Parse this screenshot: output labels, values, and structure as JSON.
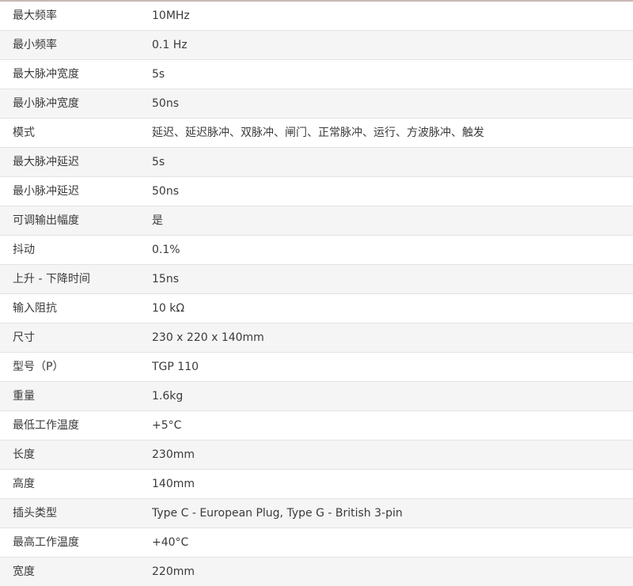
{
  "specs": [
    {
      "label": "最大频率",
      "value": "10MHz"
    },
    {
      "label": "最小频率",
      "value": "0.1 Hz"
    },
    {
      "label": "最大脉冲宽度",
      "value": "5s"
    },
    {
      "label": "最小脉冲宽度",
      "value": "50ns"
    },
    {
      "label": "模式",
      "value": "延迟、延迟脉冲、双脉冲、闸门、正常脉冲、运行、方波脉冲、触发"
    },
    {
      "label": "最大脉冲延迟",
      "value": "5s"
    },
    {
      "label": "最小脉冲延迟",
      "value": "50ns"
    },
    {
      "label": "可调输出幅度",
      "value": "是"
    },
    {
      "label": "抖动",
      "value": "0.1%"
    },
    {
      "label": "上升 - 下降时间",
      "value": "15ns"
    },
    {
      "label": "输入阻抗",
      "value": "10 kΩ"
    },
    {
      "label": "尺寸",
      "value": "230 x 220 x 140mm"
    },
    {
      "label": "型号（P）",
      "value": "TGP 110"
    },
    {
      "label": "重量",
      "value": "1.6kg"
    },
    {
      "label": "最低工作温度",
      "value": "+5°C"
    },
    {
      "label": "长度",
      "value": "230mm"
    },
    {
      "label": "高度",
      "value": "140mm"
    },
    {
      "label": "插头类型",
      "value": "Type C - European Plug, Type G - British 3-pin"
    },
    {
      "label": "最高工作温度",
      "value": "+40°C"
    },
    {
      "label": "宽度",
      "value": "220mm"
    }
  ]
}
